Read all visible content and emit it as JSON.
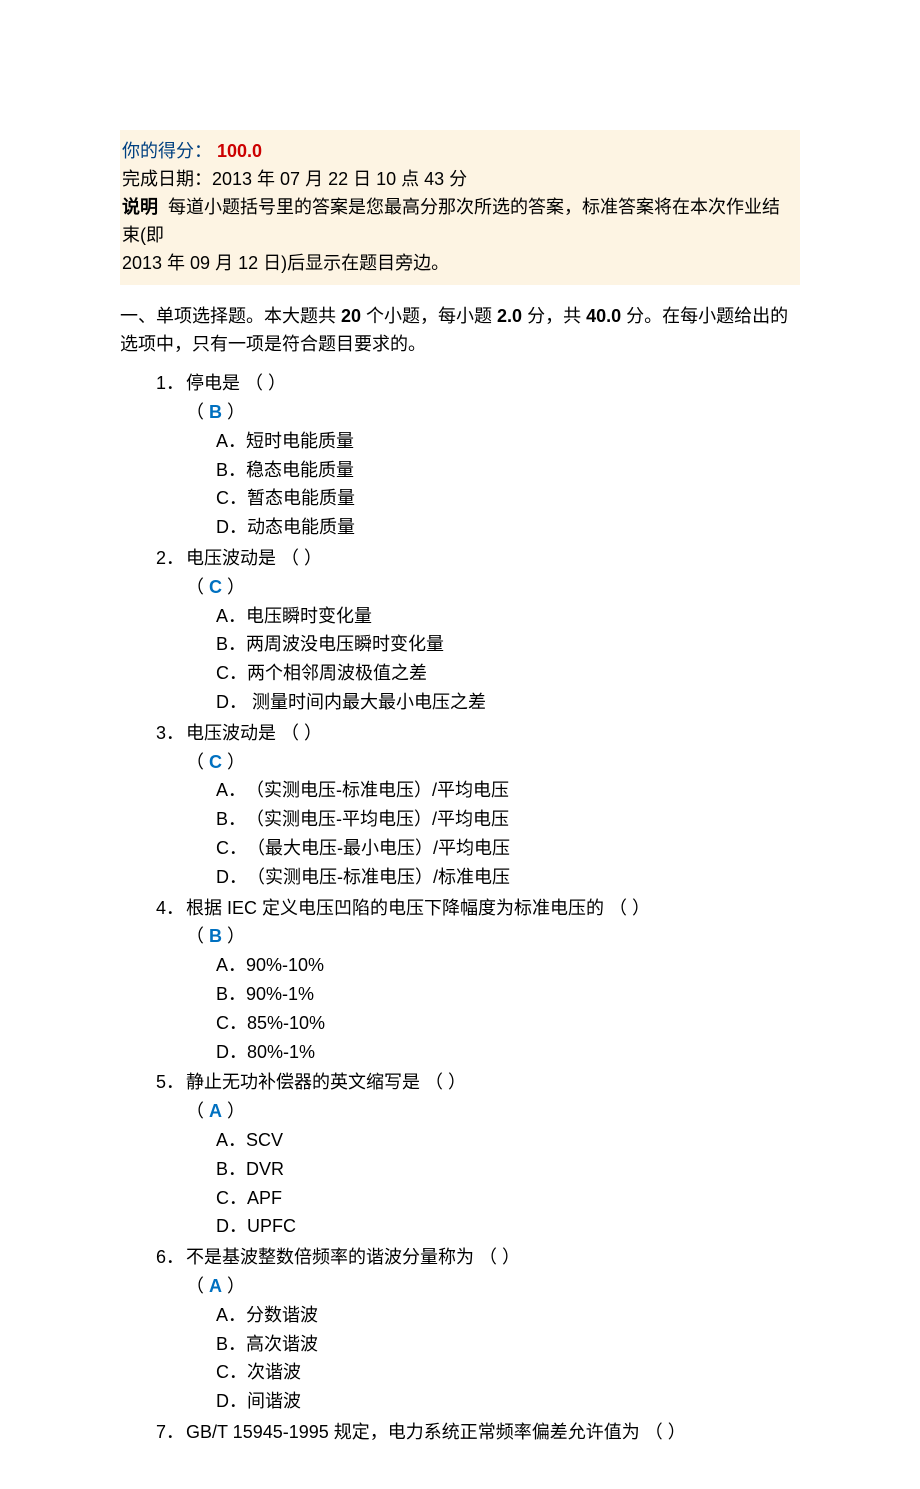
{
  "header": {
    "score_label": "你的得分：",
    "score_value": "100.0",
    "completion_prefix": "完成日期：",
    "completion_date": "2013 年 07 月 22 日 10 点 43 分",
    "note_label": "说明",
    "note_text_1": "每道小题括号里的答案是您最高分那次所选的答案，标准答案将在本次作业结束(即",
    "note_text_2": "2013 年 09 月 12 日)后显示在题目旁边。"
  },
  "section": {
    "prefix": "一、单项选择题。本大题共 ",
    "count": "20",
    "mid1": " 个小题，每小题 ",
    "points_each": "2.0",
    "mid2": " 分，共 ",
    "points_total": "40.0",
    "suffix": " 分。在每小题给出的选项中，只有一项是符合题目要求的。"
  },
  "questions": [
    {
      "num": "1．",
      "text": "停电是 （ ）",
      "answer": "B",
      "options": [
        {
          "label": "A．",
          "text": "短时电能质量"
        },
        {
          "label": "B．",
          "text": "稳态电能质量"
        },
        {
          "label": "C．",
          "text": "暂态电能质量"
        },
        {
          "label": "D．",
          "text": "动态电能质量"
        }
      ]
    },
    {
      "num": "2．",
      "text": "电压波动是 （ ）",
      "answer": "C",
      "options": [
        {
          "label": "A．",
          "text": "电压瞬时变化量"
        },
        {
          "label": "B．",
          "text": "两周波没电压瞬时变化量"
        },
        {
          "label": "C．",
          "text": "两个相邻周波极值之差"
        },
        {
          "label": "D．",
          "text": " 测量时间内最大最小电压之差"
        }
      ]
    },
    {
      "num": "3．",
      "text": "电压波动是 （ ）",
      "answer": "C",
      "options": [
        {
          "label": "A．",
          "text": "（实测电压-标准电压）/平均电压"
        },
        {
          "label": "B．",
          "text": "（实测电压-平均电压）/平均电压"
        },
        {
          "label": "C．",
          "text": "（最大电压-最小电压）/平均电压"
        },
        {
          "label": "D．",
          "text": "（实测电压-标准电压）/标准电压"
        }
      ]
    },
    {
      "num": "4．",
      "text": "根据 IEC 定义电压凹陷的电压下降幅度为标准电压的 （ ）",
      "answer": "B",
      "options": [
        {
          "label": "A．",
          "text": "90%-10%"
        },
        {
          "label": "B．",
          "text": "90%-1%"
        },
        {
          "label": "C．",
          "text": "85%-10%"
        },
        {
          "label": "D．",
          "text": "80%-1%"
        }
      ]
    },
    {
      "num": "5．",
      "text": "静止无功补偿器的英文缩写是 （ ）",
      "answer": "A",
      "options": [
        {
          "label": "A．",
          "text": "SCV"
        },
        {
          "label": "B．",
          "text": "DVR"
        },
        {
          "label": "C．",
          "text": "APF"
        },
        {
          "label": "D．",
          "text": "UPFC"
        }
      ]
    },
    {
      "num": "6．",
      "text": "不是基波整数倍频率的谐波分量称为 （ ）",
      "answer": "A",
      "options": [
        {
          "label": "A．",
          "text": "分数谐波"
        },
        {
          "label": "B．",
          "text": "高次谐波"
        },
        {
          "label": "C．",
          "text": "次谐波"
        },
        {
          "label": "D．",
          "text": "间谐波"
        }
      ]
    },
    {
      "num": "7．",
      "text": "GB/T 15945-1995 规定，电力系统正常频率偏差允许值为 （ ）",
      "answer": "",
      "options": []
    }
  ]
}
